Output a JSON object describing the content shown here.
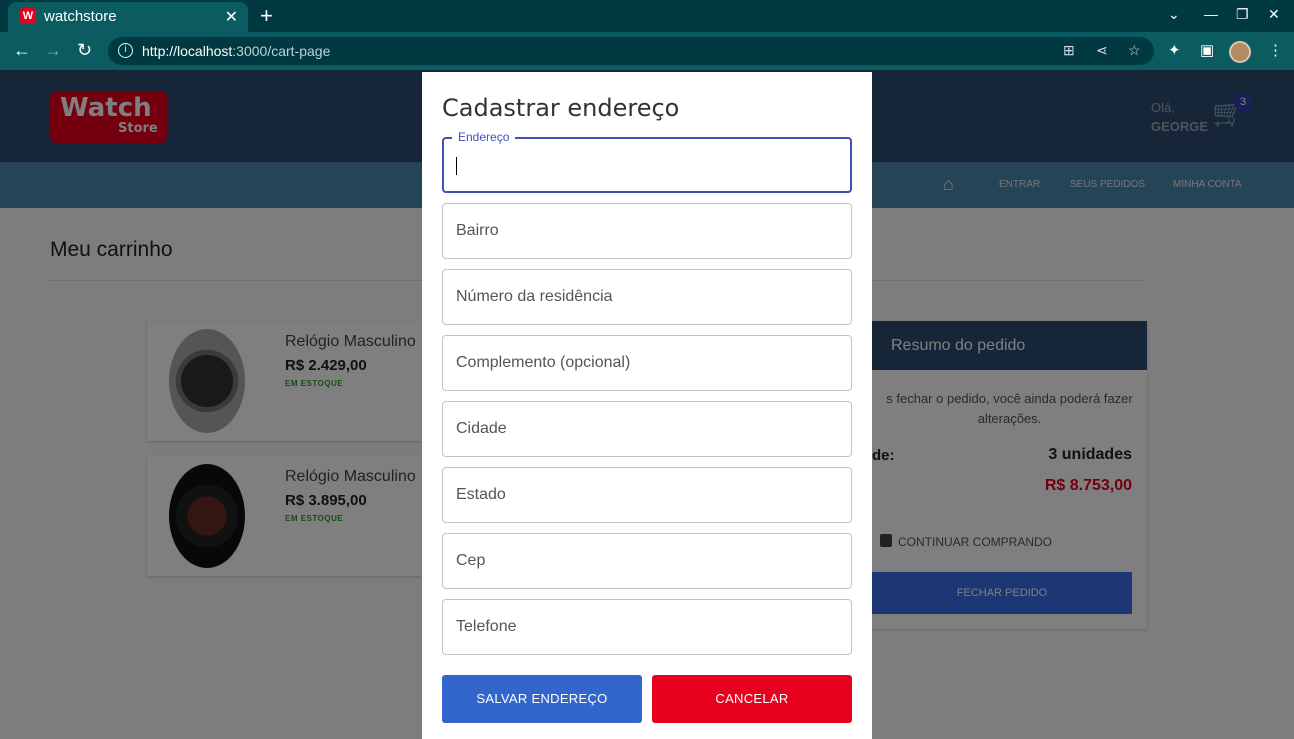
{
  "browser": {
    "tab_favicon": "W",
    "tab_title": "watchstore",
    "tab_close": "✕",
    "new_tab": "+",
    "url_host": "http://localhost",
    "url_path": ":3000/cart-page"
  },
  "header": {
    "logo_word": "Watch",
    "logo_sub": "Store",
    "greeting": "Olá,",
    "user_name": "GEORGE",
    "cart_count": "3"
  },
  "nav": {
    "links": [
      "ENTRAR",
      "SEUS PEDIDOS",
      "MINHA CONTA"
    ]
  },
  "page": {
    "title": "Meu carrinho",
    "products": [
      {
        "name": "Relógio Masculino",
        "price": "R$ 2.429,00",
        "stock": "EM ESTOQUE"
      },
      {
        "name": "Relógio Masculino",
        "price": "R$ 3.895,00",
        "stock": "EM ESTOQUE"
      }
    ],
    "summary": {
      "title": "Resumo do pedido",
      "note": "s fechar o pedido, você ainda poderá fazer alterações.",
      "qty_label": "de:",
      "qty_value": "3 unidades",
      "total": "R$ 8.753,00",
      "continue_label": "CONTINUAR COMPRANDO",
      "close_label": "FECHAR PEDIDO"
    }
  },
  "modal": {
    "title": "Cadastrar endereço",
    "fields": [
      {
        "label": "Endereço",
        "value": "",
        "focused": true
      },
      {
        "placeholder": "Bairro"
      },
      {
        "placeholder": "Número da residência"
      },
      {
        "placeholder": "Complemento (opcional)"
      },
      {
        "placeholder": "Cidade"
      },
      {
        "placeholder": "Estado"
      },
      {
        "placeholder": "Cep"
      },
      {
        "placeholder": "Telefone"
      }
    ],
    "save_label": "SALVAR ENDEREÇO",
    "cancel_label": "CANCELAR"
  },
  "colors": {
    "brand_red": "#e8001f",
    "primary_blue": "#3366cc",
    "focus_indigo": "#3f51b5",
    "header_navy": "#2f4a70"
  }
}
